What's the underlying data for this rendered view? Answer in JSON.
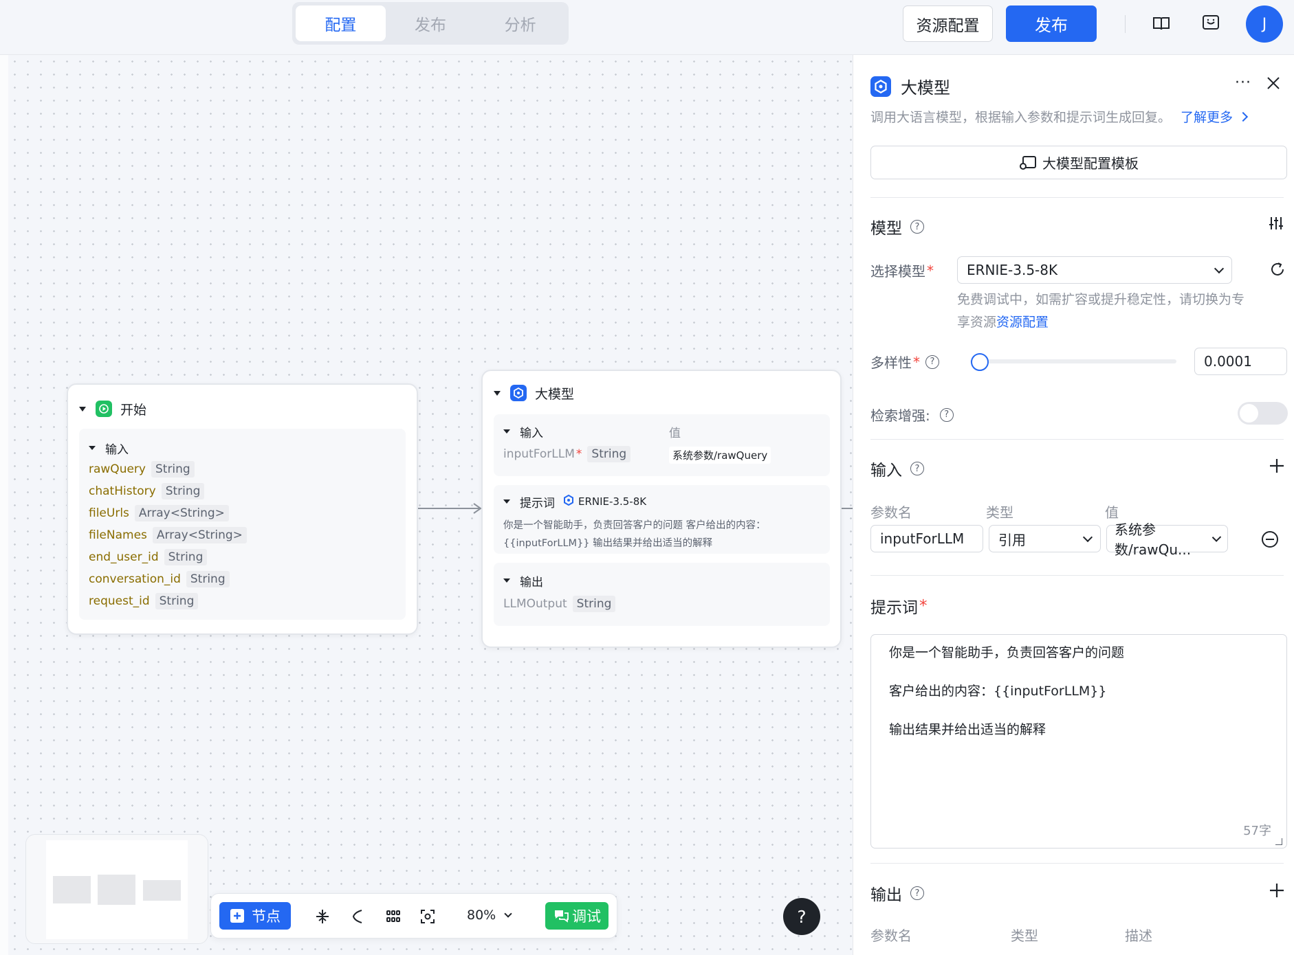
{
  "header": {
    "tabs": [
      "配置",
      "发布",
      "分析"
    ],
    "active_tab": 0,
    "resource_btn": "资源配置",
    "publish_btn": "发布",
    "avatar_letter": "J"
  },
  "start_node": {
    "title": "开始",
    "section": "输入",
    "params": [
      {
        "name": "rawQuery",
        "type": "String"
      },
      {
        "name": "chatHistory",
        "type": "String"
      },
      {
        "name": "fileUrls",
        "type": "Array<String>"
      },
      {
        "name": "fileNames",
        "type": "Array<String>"
      },
      {
        "name": "end_user_id",
        "type": "String"
      },
      {
        "name": "conversation_id",
        "type": "String"
      },
      {
        "name": "request_id",
        "type": "String"
      }
    ]
  },
  "llm_node": {
    "title": "大模型",
    "input_section": "输入",
    "value_col": "值",
    "input_name": "inputForLLM",
    "input_req": "*",
    "input_type": "String",
    "input_value": "系统参数/rawQuery",
    "prompt_section": "提示词",
    "prompt_model": "ERNIE-3.5-8K",
    "prompt_line1": "你是一个智能助手，负责回答客户的问题 客户给出的内容：",
    "prompt_line2": "{{inputForLLM}} 输出结果并给出适当的解释",
    "output_section": "输出",
    "output_name": "LLMOutput",
    "output_type": "String"
  },
  "toolbar": {
    "node_btn": "节点",
    "zoom": "80%",
    "debug_btn": "调试"
  },
  "help": "?",
  "panel": {
    "title": "大模型",
    "desc": "调用大语言模型，根据输入参数和提示词生成回复。",
    "learn_more": "了解更多",
    "template_btn": "大模型配置模板",
    "model_section": "模型",
    "select_model_label": "选择模型",
    "req": "*",
    "model_value": "ERNIE-3.5-8K",
    "model_hint1": "免费调试中，如需扩容或提升稳定性，请切换为专",
    "model_hint2": "享资源",
    "model_hint_link": "资源配置",
    "diversity_label": "多样性",
    "diversity_value": "0.0001",
    "diversity_fraction": 0.0,
    "retrieval_label": "检索增强:",
    "retrieval_on": false,
    "input_section": "输入",
    "col_name": "参数名",
    "col_type": "类型",
    "col_value": "值",
    "param_name": "inputForLLM",
    "param_type": "引用",
    "param_value": "系统参数/rawQu...",
    "prompt_section": "提示词",
    "prompt_lines": [
      "你是一个智能助手，负责回答客户的问题",
      "客户给出的内容：{{inputForLLM}}",
      "输出结果并给出适当的解释"
    ],
    "char_count": "57字",
    "output_section": "输出",
    "out_col_name": "参数名",
    "out_col_type": "类型",
    "out_col_desc": "描述"
  }
}
